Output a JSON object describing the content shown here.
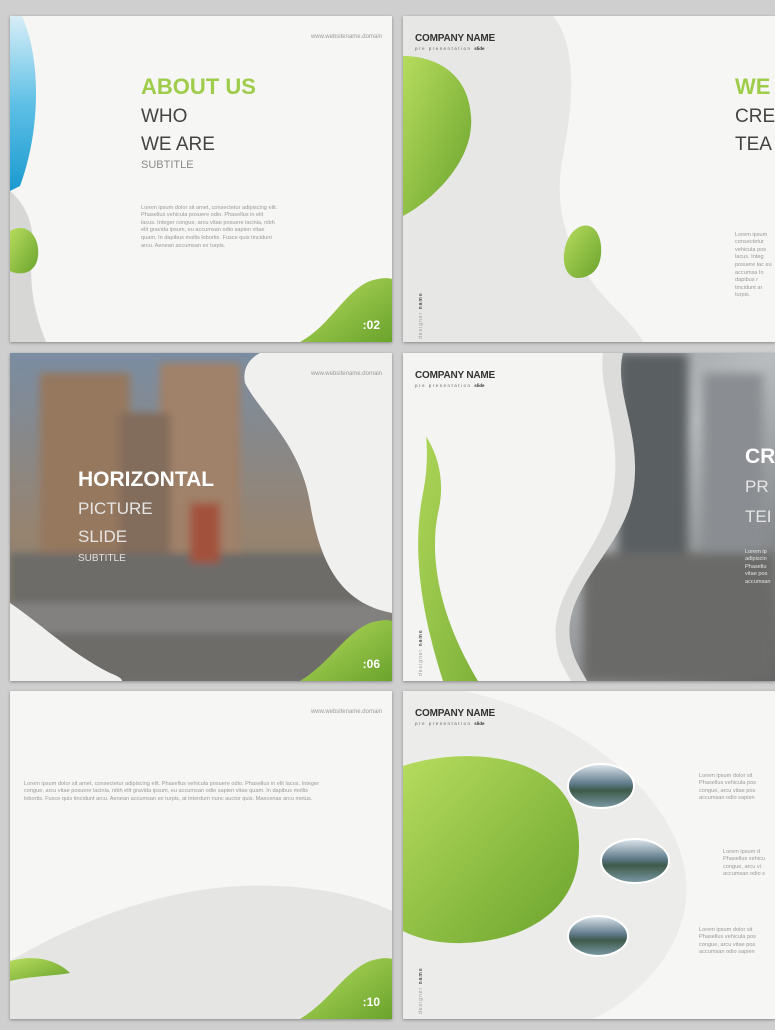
{
  "site": "www.websitename.domain",
  "company": {
    "name": "COMPANY NAME",
    "sub": "pre presentation",
    "sub_bold": "slide"
  },
  "designer": {
    "prefix": "designer ",
    "name": "name"
  },
  "slide1": {
    "title": "ABOUT US",
    "line1": "WHO",
    "line2": "WE ARE",
    "subtitle": "SUBTITLE",
    "body": "Lorem ipsum dolor sit amet, consectetur adipiscing elit. Phasellus vehicula posuere odio. Phasellus in elit lacus. Integer congue, arcu vitae posuere lacinia, nibh elit gravida ipsum, eu accumsan odio sapien vitae quam. In dapibus mollis lobortis. Fusce quis tincidunt arcu. Aenean accumsan ex turpis.",
    "number": ":02"
  },
  "slide2": {
    "title": "WE",
    "line1": "CRE",
    "line2": "TEA",
    "body": "Lorem ipsum consectetur vehicula pos lacus. Integ posuere lac eu accumsa In dapibus r tincidunt ar turpis."
  },
  "slide3": {
    "line1": "HORIZONTAL",
    "line2": "PICTURE",
    "line3": "SLIDE",
    "subtitle": "SUBTITLE",
    "number": ":06"
  },
  "slide4": {
    "line1": "CR",
    "line2": "PR",
    "line3": "TEI",
    "body": "Lorem ip adipiscin Phasellu vitae pos accumsan"
  },
  "slide5": {
    "body": "Lorem ipsum dolor sit amet, consectetur adipiscing elit. Phasellus vehicula posuere odio. Phasellus in elit lacus. Integer congue, arcu vitae posuere lacinia, nibh elit gravida ipsum, eu accumsan odio sapien vitae quam. In dapibus mollis lobortis. Fusce quis tincidunt arcu. Aenean accumsan ex turpis, at interdum nunc auctor quis. Maecenas arcu metus.",
    "number": ":10"
  },
  "slide6": {
    "text1": "Lorem ipsum dolor sit Phasellus vehicula pos congue, arcu vitae pos accumsan odio sapien",
    "text2": "Lorem ipsum d Phasellus vehicu congue, arcu vi accumsan odio s",
    "text3": "Lorem ipsum dolor sit Phasellus vehicula pos congue, arcu vitae pos accumsan odio sapien"
  },
  "colors": {
    "accent": "#9fcd4b",
    "accent_dark": "#6aa32c",
    "paper": "#f6f6f4"
  }
}
